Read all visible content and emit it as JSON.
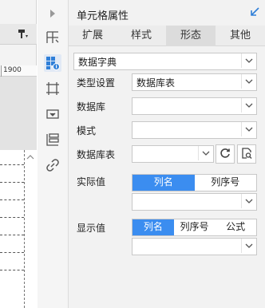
{
  "left_editor": {
    "ruler_value": "1900"
  },
  "panel": {
    "title": "单元格属性"
  },
  "tabs": [
    {
      "label": "扩展",
      "active": false
    },
    {
      "label": "样式",
      "active": false
    },
    {
      "label": "形态",
      "active": true
    },
    {
      "label": "其他",
      "active": false
    }
  ],
  "form": {
    "form_type": "数据字典",
    "type_setting_label": "类型设置",
    "type_setting_value": "数据库表",
    "database_label": "数据库",
    "database_value": "",
    "schema_label": "模式",
    "schema_value": "",
    "table_label": "数据库表",
    "table_value": "",
    "actual_value_label": "实际值",
    "actual_value_options": [
      "列名",
      "列序号"
    ],
    "actual_value_selected": "列名",
    "actual_value_field": "",
    "display_value_label": "显示值",
    "display_value_options": [
      "列名",
      "列序号",
      "公式"
    ],
    "display_value_selected": "列名",
    "display_value_field": ""
  },
  "colors": {
    "accent": "#3b8df0",
    "icon_blue": "#2f7fd8"
  },
  "icons": [
    "play-right-icon",
    "merge-cells-icon",
    "cell-attribute-icon",
    "border-icon",
    "widget-icon",
    "list-icon",
    "hyperlink-icon",
    "refresh-icon",
    "preview-icon",
    "chevron-down-icon",
    "collapse-arrow-icon"
  ]
}
